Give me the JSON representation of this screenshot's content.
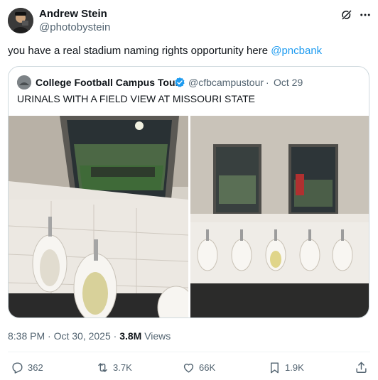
{
  "author": {
    "name": "Andrew Stein",
    "handle": "@photobystein"
  },
  "tweet": {
    "text": "you have a real stadium naming rights opportunity here ",
    "mention": "@pncbank"
  },
  "quote": {
    "name": "College Football Campus Tour",
    "handle": "@cfbcampustour",
    "separator": "·",
    "date": "Oct 29",
    "text": "URINALS WITH A FIELD VIEW AT MISSOURI STATE"
  },
  "meta": {
    "time": "8:38 PM · Oct 30, 2025 · ",
    "views_count": "3.8M",
    "views_label": " Views"
  },
  "actions": {
    "replies": "362",
    "reposts": "3.7K",
    "likes": "66K",
    "bookmarks": "1.9K"
  },
  "colors": {
    "link": "#1d9bf0",
    "secondary_text": "#536471",
    "border": "#cfd9de",
    "verified": "#1d9bf0"
  },
  "icons": [
    "grok-icon",
    "more-icon",
    "verified-icon",
    "reply-icon",
    "retweet-icon",
    "like-icon",
    "bookmark-icon",
    "share-icon"
  ]
}
